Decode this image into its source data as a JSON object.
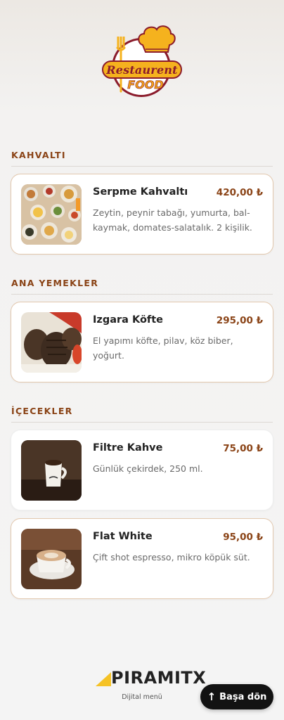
{
  "header": {
    "logo_text_top": "Restaurent",
    "logo_text_bottom": "FOOD"
  },
  "sections": [
    {
      "title": "KAHVALTI",
      "items": [
        {
          "name": "Serpme Kahvaltı",
          "price": "420,00 ₺",
          "description": "Zeytin, peynir tabağı, yumurta, bal-kaymak, domates-salatalık. 2 kişilik."
        }
      ]
    },
    {
      "title": "ANA YEMEKLER",
      "items": [
        {
          "name": "Izgara Köfte",
          "price": "295,00 ₺",
          "description": "El yapımı köfte, pilav, köz biber, yoğurt."
        }
      ]
    },
    {
      "title": "İÇECEKLER",
      "items": [
        {
          "name": "Filtre Kahve",
          "price": "75,00 ₺",
          "description": "Günlük çekirdek, 250 ml."
        },
        {
          "name": "Flat White",
          "price": "95,00 ₺",
          "description": "Çift shot espresso, mikro köpük süt."
        }
      ]
    }
  ],
  "footer": {
    "brand": "PIRAMITX",
    "brand_sub": "Dijital menü",
    "back_to_top": "Başa dön",
    "back_to_top_icon": "arrow-up-icon"
  },
  "colors": {
    "accent": "#8a4316",
    "card_border": "#e2c7ad",
    "logo_maroon": "#8b1c2c",
    "logo_gold": "#f5b21e"
  }
}
